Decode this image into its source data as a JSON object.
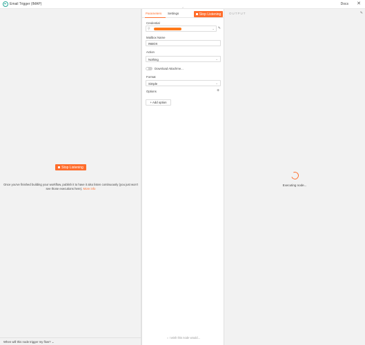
{
  "window": {
    "title": "Email Trigger (IMAP)",
    "docs_label": "Docs",
    "close_icon": "✕"
  },
  "left_panel": {
    "stop_button_label": "Stop Listening",
    "description": "Once you've finished building your workflow, publish it to have it also listen continuously (you just won't see those executions here).",
    "more_info_label": "More info",
    "bottom_question": "When will this node trigger my flow?"
  },
  "center_panel": {
    "tabs": [
      {
        "label": "Parameters",
        "active": true
      },
      {
        "label": "Settings",
        "active": false
      }
    ],
    "stop_button_label": "Stop Listening",
    "fields": {
      "credential_label": "Credential",
      "mailbox_label": "Mailbox Name",
      "mailbox_value": "INBOX",
      "action_label": "Action",
      "action_value": "Nothing",
      "download_attachments_label": "Download Attachme...",
      "download_attachments_enabled": false,
      "format_label": "Format",
      "format_value": "Simple",
      "options_label": "Options"
    },
    "add_option_label": "Add option",
    "wish_text": "I wish this node would..."
  },
  "right_panel": {
    "output_label": "OUTPUT",
    "status_text": "Executing node..."
  },
  "colors": {
    "accent": "#ff6d2c",
    "brand_teal": "#25a596"
  }
}
